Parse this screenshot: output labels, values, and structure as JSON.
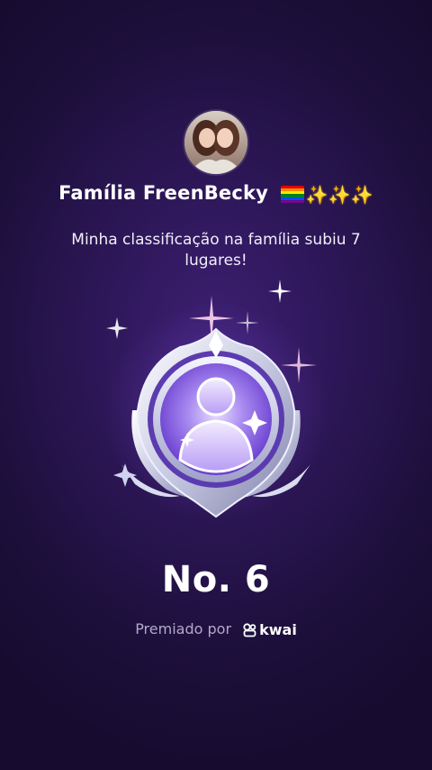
{
  "header": {
    "family_name": "Família FreenBecky",
    "sparkles": "✨✨✨"
  },
  "message": "Minha classificação na família subiu 7 lugares!",
  "rank": {
    "label": "No. 6"
  },
  "footer": {
    "awarded_by": "Premiado por",
    "brand": "kwai"
  },
  "icons": [
    "avatar",
    "rainbow-flag-icon",
    "sparkles-icon",
    "medal-icon",
    "kwai-logo-icon"
  ],
  "colors": {
    "background": "#1c0f3a",
    "medal_accent": "#8b5cf6",
    "sparkle": "#ffd23a"
  }
}
